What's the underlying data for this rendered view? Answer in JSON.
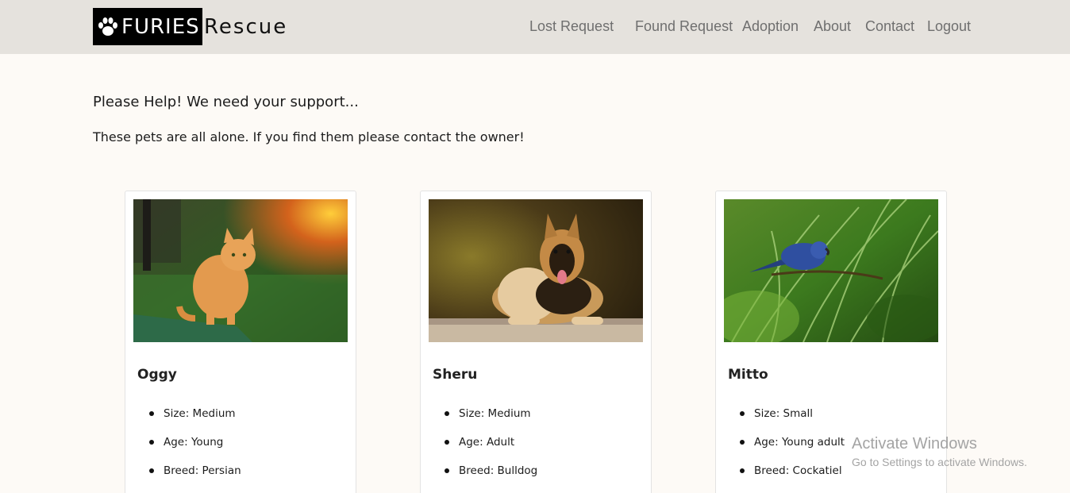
{
  "brand": {
    "part1": "FURIES",
    "part2": "Rescue"
  },
  "nav": {
    "lost": "Lost Request",
    "found": "Found Request",
    "adoption": "Adoption",
    "about": "About",
    "contact": "Contact",
    "logout": "Logout"
  },
  "intro": {
    "title": "Please Help! We need your support...",
    "subtitle": "These pets are all alone. If you find them please contact the owner!"
  },
  "pets": [
    {
      "name": "Oggy",
      "size": "Size: Medium",
      "age": "Age: Young",
      "breed": "Breed: Persian"
    },
    {
      "name": "Sheru",
      "size": "Size: Medium",
      "age": "Age: Adult",
      "breed": "Breed: Bulldog"
    },
    {
      "name": "Mitto",
      "size": "Size: Small",
      "age": "Age: Young adult",
      "breed": "Breed: Cockatiel"
    }
  ],
  "watermark": {
    "line1": "Activate Windows",
    "line2": "Go to Settings to activate Windows."
  },
  "colors": {
    "navbar": "#e5e2dd",
    "page": "#fdfaf6",
    "brand_box": "#000000",
    "nav_text": "#6f6f6f"
  }
}
